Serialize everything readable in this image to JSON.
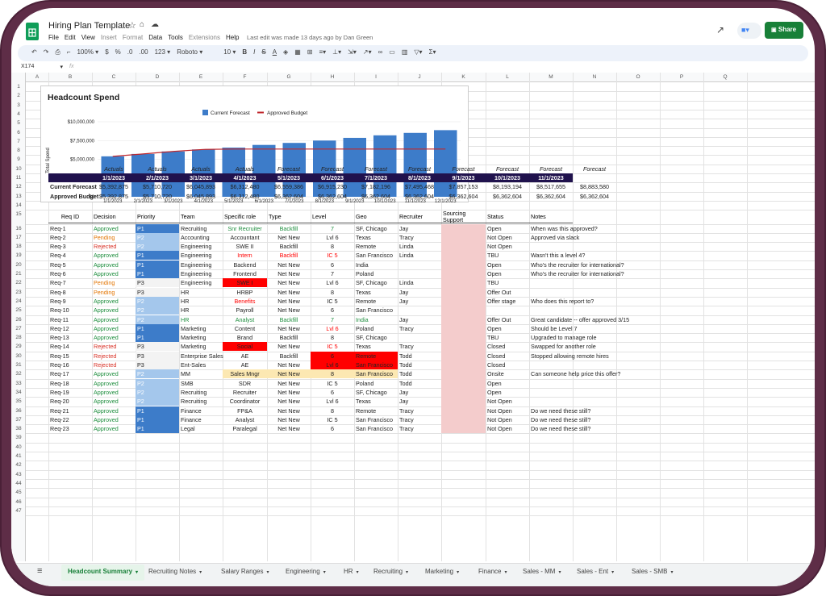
{
  "doc": {
    "title": "Hiring Plan Template",
    "last_edit": "Last edit was made 13 days ago by Dan Green"
  },
  "menu": [
    "File",
    "Edit",
    "View",
    "Insert",
    "Format",
    "Data",
    "Tools",
    "Extensions",
    "Help"
  ],
  "share": "Share",
  "toolbar": {
    "zoom": "100%",
    "currency": "$",
    "percent": "%",
    "dec_less": ".0",
    "dec_more": ".00",
    "format": "123",
    "font": "Roboto",
    "size": "10"
  },
  "namebox": "X174",
  "fx": "fx",
  "columns": [
    "A",
    "B",
    "C",
    "D",
    "E",
    "F",
    "G",
    "H",
    "I",
    "J",
    "K",
    "L",
    "M",
    "N",
    "O",
    "P",
    "Q"
  ],
  "rows": [
    "1",
    "2",
    "3",
    "4",
    "5",
    "6",
    "7",
    "8",
    "9",
    "10",
    "11",
    "12",
    "13",
    "14",
    "15",
    "16",
    "17",
    "18",
    "19",
    "20",
    "21",
    "22",
    "23",
    "24",
    "25",
    "26",
    "27",
    "28",
    "29",
    "30",
    "31",
    "32",
    "33",
    "34",
    "35",
    "36",
    "37",
    "38",
    "39",
    "40",
    "41",
    "42",
    "43",
    "44",
    "45",
    "46",
    "47"
  ],
  "chart_data": {
    "type": "bar",
    "title": "Headcount Spend",
    "ylabel": "Total Spend",
    "ylim": [
      0,
      10000000
    ],
    "yticks": [
      "$10,000,000",
      "$7,500,000",
      "$5,000,000",
      "$2,500,000",
      "$0"
    ],
    "categories": [
      "1/1/2023",
      "2/1/2023",
      "3/1/2023",
      "4/1/2023",
      "5/1/2023",
      "6/1/2023",
      "7/1/2023",
      "8/1/2023",
      "9/1/2023",
      "10/1/2023",
      "11/1/2023",
      "12/1/2023"
    ],
    "series": [
      {
        "name": "Current Forecast",
        "type": "bar",
        "color": "#3d7cc9",
        "values": [
          5392875,
          5710720,
          6045893,
          6312480,
          6559386,
          6915230,
          7182196,
          7495468,
          7857153,
          8193194,
          8517655,
          8883580
        ]
      },
      {
        "name": "Approved Budget",
        "type": "line",
        "color": "#c0262b",
        "values": [
          5392875,
          5710720,
          6045893,
          6312480,
          6362604,
          6362604,
          6362604,
          6362604,
          6362604,
          6362604,
          6362604,
          6362604
        ]
      }
    ]
  },
  "summary": {
    "labels": [
      "Actuals",
      "Actuals",
      "Actuals",
      "Actuals",
      "Forecast",
      "Forecast",
      "Forecast",
      "Forecast",
      "Forecast",
      "Forecast",
      "Forecast",
      "Forecast"
    ],
    "dates": [
      "1/1/2023",
      "2/1/2023",
      "3/1/2023",
      "4/1/2023",
      "5/1/2023",
      "6/1/2023",
      "7/1/2023",
      "8/1/2023",
      "9/1/2023",
      "10/1/2023",
      "11/1/2023",
      "12/1/2023"
    ],
    "cf_label": "Current Forecast",
    "ab_label": "Approved Budget",
    "cf": [
      "$5,392,875",
      "$5,710,720",
      "$6,045,893",
      "$6,312,480",
      "$6,559,386",
      "$6,915,230",
      "$7,182,196",
      "$7,495,468",
      "$7,857,153",
      "$8,193,194",
      "$8,517,655",
      "$8,883,580"
    ],
    "ab": [
      "$5,392,875",
      "$5,710,720",
      "$6,045,893",
      "$6,312,480",
      "$6,362,604",
      "$6,362,604",
      "$6,362,604",
      "$6,362,604",
      "$6,362,604",
      "$6,362,604",
      "$6,362,604",
      "$6,362,604"
    ]
  },
  "table": {
    "headers": [
      "Req ID",
      "Decision",
      "Priority",
      "Team",
      "Specific role",
      "Type",
      "Level",
      "Geo",
      "Recruiter",
      "Sourcing Support",
      "Status",
      "Notes"
    ],
    "rows": [
      [
        "Req-1",
        "Approved",
        "P1",
        "Recruiting",
        "Snr Recruiter",
        "Backfill",
        "7",
        "SF, Chicago",
        "Jay",
        "Open",
        "When was this approved?"
      ],
      [
        "Req-2",
        "Pending",
        "P2",
        "Accounting",
        "Accountant",
        "Net New",
        "Lvl 6",
        "Texas",
        "Tracy",
        "Not Open",
        "Approved via slack"
      ],
      [
        "Req-3",
        "Rejected",
        "P2",
        "Engineering",
        "SWE II",
        "Backfill",
        "8",
        "Remote",
        "Linda",
        "Not Open",
        ""
      ],
      [
        "Req-4",
        "Approved",
        "P1",
        "Engineering",
        "Intern",
        "Backfill",
        "IC 5",
        "San Francisco",
        "Linda",
        "TBU",
        "Wasn't this a level 4?"
      ],
      [
        "Req-5",
        "Approved",
        "P1",
        "Engineering",
        "Backend",
        "Net New",
        "6",
        "India",
        "",
        "Open",
        "Who's the recruiter for international?"
      ],
      [
        "Req-6",
        "Approved",
        "P1",
        "Engineering",
        "Frontend",
        "Net New",
        "7",
        "Poland",
        "",
        "Open",
        "Who's the recruiter for international?"
      ],
      [
        "Req-7",
        "Pending",
        "P3",
        "Engineering",
        "SWE I",
        "Net New",
        "Lvl 6",
        "SF, Chicago",
        "Linda",
        "TBU",
        ""
      ],
      [
        "Req-8",
        "Pending",
        "P3",
        "HR",
        "HRBP",
        "Net New",
        "8",
        "Texas",
        "Jay",
        "Offer Out",
        ""
      ],
      [
        "Req-9",
        "Approved",
        "P2",
        "HR",
        "Benefits",
        "Net New",
        "IC 5",
        "Remote",
        "Jay",
        "Offer stage",
        "Who does this report to?"
      ],
      [
        "Req-10",
        "Approved",
        "P2",
        "HR",
        "Payroll",
        "Net New",
        "6",
        "San Francisco",
        "",
        "",
        ""
      ],
      [
        "Req-11",
        "Approved",
        "P2",
        "HR",
        "Analyst",
        "Backfill",
        "7",
        "India",
        "Jay",
        "Offer Out",
        "Great candidate -- offer approved 3/15"
      ],
      [
        "Req-12",
        "Approved",
        "P1",
        "Marketing",
        "Content",
        "Net New",
        "Lvl 6",
        "Poland",
        "Tracy",
        "Open",
        "Should be Level 7"
      ],
      [
        "Req-13",
        "Approved",
        "P1",
        "Marketing",
        "Brand",
        "Backfill",
        "8",
        "SF, Chicago",
        "",
        "TBU",
        "Upgraded to manage role"
      ],
      [
        "Req-14",
        "Rejected",
        "P3",
        "Marketing",
        "Social",
        "Net New",
        "IC 5",
        "Texas",
        "Tracy",
        "Closed",
        "Swapped for another role"
      ],
      [
        "Req-15",
        "Rejected",
        "P3",
        "Enterprise Sales",
        "AE",
        "Backfill",
        "6",
        "Remote",
        "Todd",
        "Closed",
        "Stopped allowing remote hires"
      ],
      [
        "Req-16",
        "Rejected",
        "P3",
        "Ent-Sales",
        "AE",
        "Net New",
        "Lvl 6",
        "San Francisco",
        "Todd",
        "Closed",
        ""
      ],
      [
        "Req-17",
        "Approved",
        "P2",
        "MM",
        "Sales Mngr",
        "Net New",
        "8",
        "San Francisco",
        "Todd",
        "Onsite",
        "Can someone help price this offer?"
      ],
      [
        "Req-18",
        "Approved",
        "P2",
        "SMB",
        "SDR",
        "Net New",
        "IC 5",
        "Poland",
        "Todd",
        "Open",
        ""
      ],
      [
        "Req-19",
        "Approved",
        "P2",
        "Recruiting",
        "Recruiter",
        "Net New",
        "6",
        "SF, Chicago",
        "Jay",
        "Open",
        ""
      ],
      [
        "Req-20",
        "Approved",
        "P2",
        "Recruiting",
        "Coordinator",
        "Net New",
        "Lvl 6",
        "Texas",
        "Jay",
        "Not Open",
        ""
      ],
      [
        "Req-21",
        "Approved",
        "P1",
        "Finance",
        "FP&A",
        "Net New",
        "8",
        "Remote",
        "Tracy",
        "Not Open",
        "Do we need these still?"
      ],
      [
        "Req-22",
        "Approved",
        "P1",
        "Finance",
        "Analyst",
        "Net New",
        "IC 5",
        "San Francisco",
        "Tracy",
        "Not Open",
        "Do we need these still?"
      ],
      [
        "Req-23",
        "Approved",
        "P1",
        "Legal",
        "Paralegal",
        "Net New",
        "6",
        "San Francisco",
        "Tracy",
        "Not Open",
        "Do we need these still?"
      ]
    ]
  },
  "tabs": [
    "Headcount Summary",
    "Recruiting Notes",
    "Salary Ranges",
    "Engineering",
    "HR",
    "Recruiting",
    "Marketing",
    "Finance",
    "Sales - MM",
    "Sales - Ent",
    "Sales - SMB"
  ],
  "colors": {
    "approved": "#1e8e3e",
    "pending": "#e37400",
    "rejected": "#d93025",
    "p1": "#3d7cc9",
    "p2": "#a4c7ec",
    "red": "#ff0000",
    "peach": "#fce8b2",
    "pink": "#f4cccc",
    "dark": "#20124d",
    "share": "#188038"
  }
}
